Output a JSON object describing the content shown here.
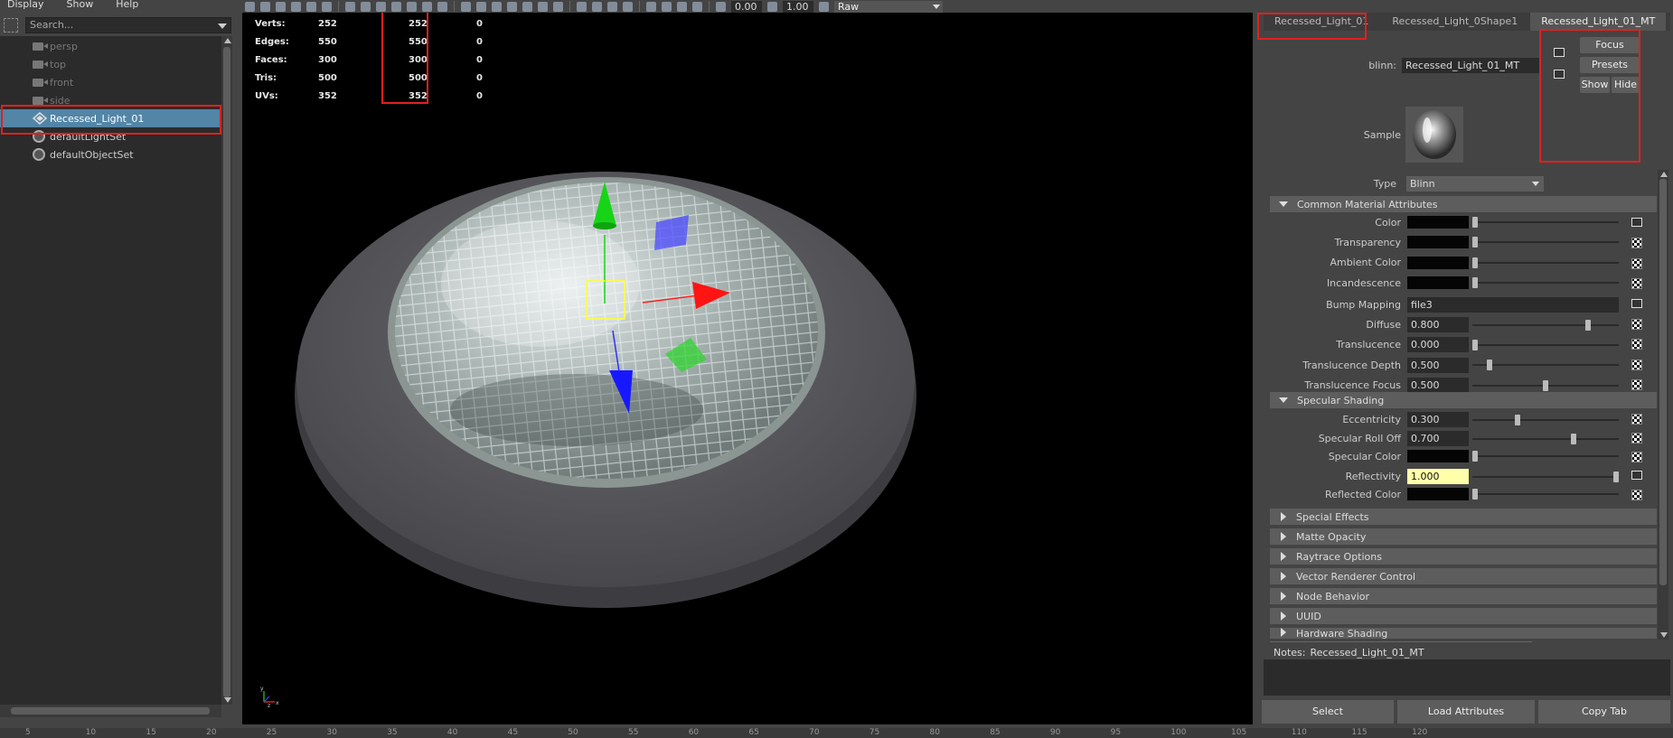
{
  "outliner": {
    "menu": [
      "Display",
      "Show",
      "Help"
    ],
    "search_placeholder": "Search...",
    "items": [
      {
        "label": "persp",
        "icon": "camera-icon",
        "dim": true
      },
      {
        "label": "top",
        "icon": "camera-icon",
        "dim": true
      },
      {
        "label": "front",
        "icon": "camera-icon",
        "dim": true
      },
      {
        "label": "side",
        "icon": "camera-icon",
        "dim": true
      },
      {
        "label": "Recessed_Light_01",
        "icon": "mesh-transform-icon",
        "selected": true
      },
      {
        "label": "defaultLightSet",
        "icon": "set-icon"
      },
      {
        "label": "defaultObjectSet",
        "icon": "set-icon"
      }
    ]
  },
  "toolbar": {
    "exposure": "0.00",
    "gamma": "1.00",
    "color_space": "Raw"
  },
  "hud": {
    "rows": [
      {
        "label": "Verts:",
        "v1": "252",
        "v2": "252",
        "v3": "0"
      },
      {
        "label": "Edges:",
        "v1": "550",
        "v2": "550",
        "v3": "0"
      },
      {
        "label": "Faces:",
        "v1": "300",
        "v2": "300",
        "v3": "0"
      },
      {
        "label": "Tris:",
        "v1": "500",
        "v2": "500",
        "v3": "0"
      },
      {
        "label": "UVs:",
        "v1": "352",
        "v2": "352",
        "v3": "0"
      }
    ]
  },
  "axis": {
    "x": "x",
    "y": "y",
    "z": "z"
  },
  "attribute_editor": {
    "tabs": [
      "Recessed_Light_01",
      "Recessed_Light_0Shape1",
      "Recessed_Light_01_MT"
    ],
    "active_tab": 2,
    "node_type_label": "blinn:",
    "node_name": "Recessed_Light_01_MT",
    "buttons": {
      "focus": "Focus",
      "presets": "Presets",
      "show": "Show",
      "hide": "Hide"
    },
    "sample_label": "Sample",
    "type_label": "Type",
    "type_value": "Blinn",
    "sections": {
      "common": "Common Material Attributes",
      "specular": "Specular Shading",
      "collapsed": [
        "Special Effects",
        "Matte Opacity",
        "Raytrace Options",
        "Vector Renderer Control",
        "Node Behavior",
        "UUID",
        "Hardware Shading"
      ]
    },
    "common_attrs": [
      {
        "label": "Color",
        "kind": "swatch",
        "slider": 0.0,
        "map": "connected"
      },
      {
        "label": "Transparency",
        "kind": "swatch",
        "slider": 0.0,
        "map": "checker"
      },
      {
        "label": "Ambient Color",
        "kind": "swatch",
        "slider": 0.0,
        "map": "checker"
      },
      {
        "label": "Incandescence",
        "kind": "swatch",
        "slider": 0.0,
        "map": "checker"
      },
      {
        "label": "Bump Mapping",
        "kind": "text",
        "value": "file3",
        "map": "connected"
      },
      {
        "label": "Diffuse",
        "kind": "number",
        "value": "0.800",
        "slider": 0.8,
        "map": "checker"
      },
      {
        "label": "Translucence",
        "kind": "number",
        "value": "0.000",
        "slider": 0.0,
        "map": "checker"
      },
      {
        "label": "Translucence Depth",
        "kind": "number",
        "value": "0.500",
        "slider": 0.1,
        "map": "checker"
      },
      {
        "label": "Translucence Focus",
        "kind": "number",
        "value": "0.500",
        "slider": 0.5,
        "map": "checker"
      }
    ],
    "specular_attrs": [
      {
        "label": "Eccentricity",
        "kind": "number",
        "value": "0.300",
        "slider": 0.3,
        "map": "checker"
      },
      {
        "label": "Specular Roll Off",
        "kind": "number",
        "value": "0.700",
        "slider": 0.7,
        "map": "checker"
      },
      {
        "label": "Specular Color",
        "kind": "swatch",
        "slider": 0.0,
        "map": "checker"
      },
      {
        "label": "Reflectivity",
        "kind": "number",
        "value": "1.000",
        "slider": 1.0,
        "map": "connected",
        "highlight": true
      },
      {
        "label": "Reflected Color",
        "kind": "swatch",
        "slider": 0.0,
        "map": "checker"
      }
    ],
    "notes_label": "Notes:",
    "notes_value": "Recessed_Light_01_MT",
    "bottom_buttons": [
      "Select",
      "Load Attributes",
      "Copy Tab"
    ]
  },
  "timeline": {
    "ticks": [
      "5",
      "10",
      "15",
      "20",
      "25",
      "30",
      "35",
      "40",
      "45",
      "50",
      "55",
      "60",
      "65",
      "70",
      "75",
      "80",
      "85",
      "90",
      "95",
      "100",
      "105",
      "110",
      "115",
      "120"
    ]
  },
  "colors": {
    "selection": "#5285a6",
    "highlight_field": "#ffffaa",
    "annotation": "#e02020"
  }
}
